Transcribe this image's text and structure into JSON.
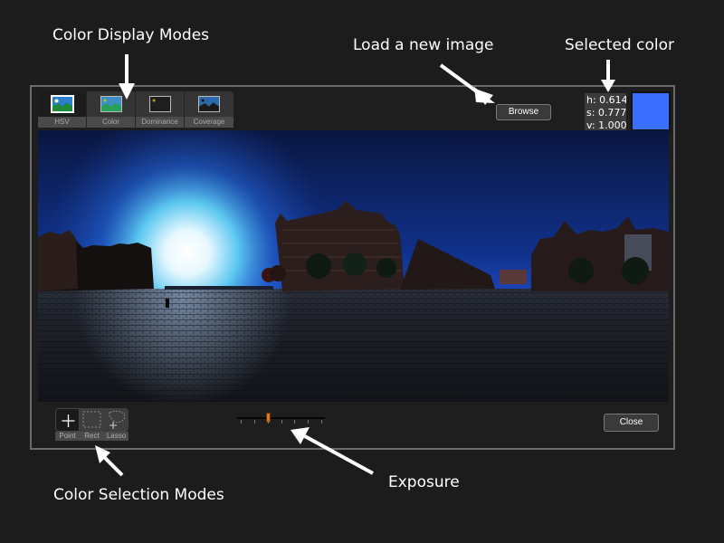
{
  "callouts": {
    "display_modes": "Color Display Modes",
    "load_image": "Load a new image",
    "selected_color": "Selected color",
    "selection_modes": "Color Selection Modes",
    "exposure": "Exposure"
  },
  "display_modes": [
    {
      "label": "HSV",
      "icon": "image-hsv-icon",
      "active": true
    },
    {
      "label": "Color",
      "icon": "image-color-icon",
      "active": false
    },
    {
      "label": "Dominance",
      "icon": "image-dominance-icon",
      "active": false
    },
    {
      "label": "Coverage",
      "icon": "image-coverage-icon",
      "active": false
    }
  ],
  "browse_label": "Browse",
  "selected_color": {
    "h_line": "h: 0.614",
    "s_line": "s: 0.777",
    "v_line": "v: 1.000",
    "swatch_hex": "#3a6fff"
  },
  "selection_modes": [
    {
      "label": "Point",
      "icon": "crosshair-plus-icon",
      "active": true
    },
    {
      "label": "Rect",
      "icon": "dashed-rect-icon",
      "active": false
    },
    {
      "label": "Lasso",
      "icon": "lasso-icon",
      "active": false
    }
  ],
  "exposure": {
    "tick_count": 7,
    "value_fraction": 0.333
  },
  "close_label": "Close",
  "colors": {
    "handle": "#e07b1a",
    "sky_top": "#0a1640",
    "sky_glow": "#bfe8ff"
  }
}
